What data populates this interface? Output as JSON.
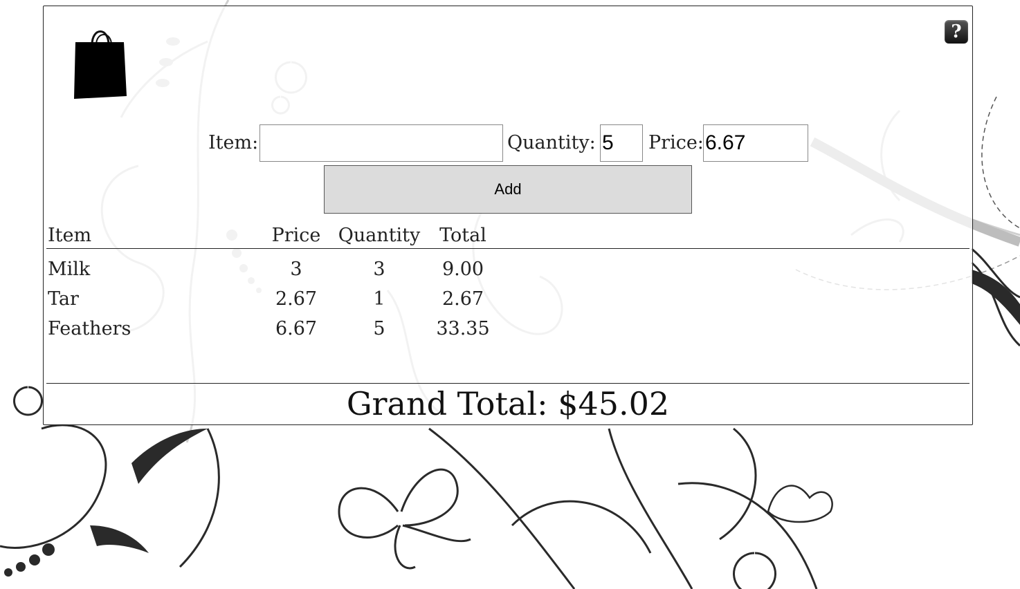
{
  "form": {
    "item_label": "Item:",
    "item_value": "",
    "quantity_label": "Quantity:",
    "quantity_value": "5",
    "price_label": "Price:",
    "price_value": "6.67",
    "add_label": "Add"
  },
  "help": {
    "label": "?"
  },
  "table": {
    "headers": {
      "item": "Item",
      "price": "Price",
      "quantity": "Quantity",
      "total": "Total"
    },
    "rows": [
      {
        "item": "Milk",
        "price": "3",
        "quantity": "3",
        "total": "9.00"
      },
      {
        "item": "Tar",
        "price": "2.67",
        "quantity": "1",
        "total": "2.67"
      },
      {
        "item": "Feathers",
        "price": "6.67",
        "quantity": "5",
        "total": "33.35"
      }
    ]
  },
  "grand_total": "Grand Total: $45.02",
  "icons": {
    "bag": "shopping-bag-icon",
    "help": "help-icon"
  }
}
